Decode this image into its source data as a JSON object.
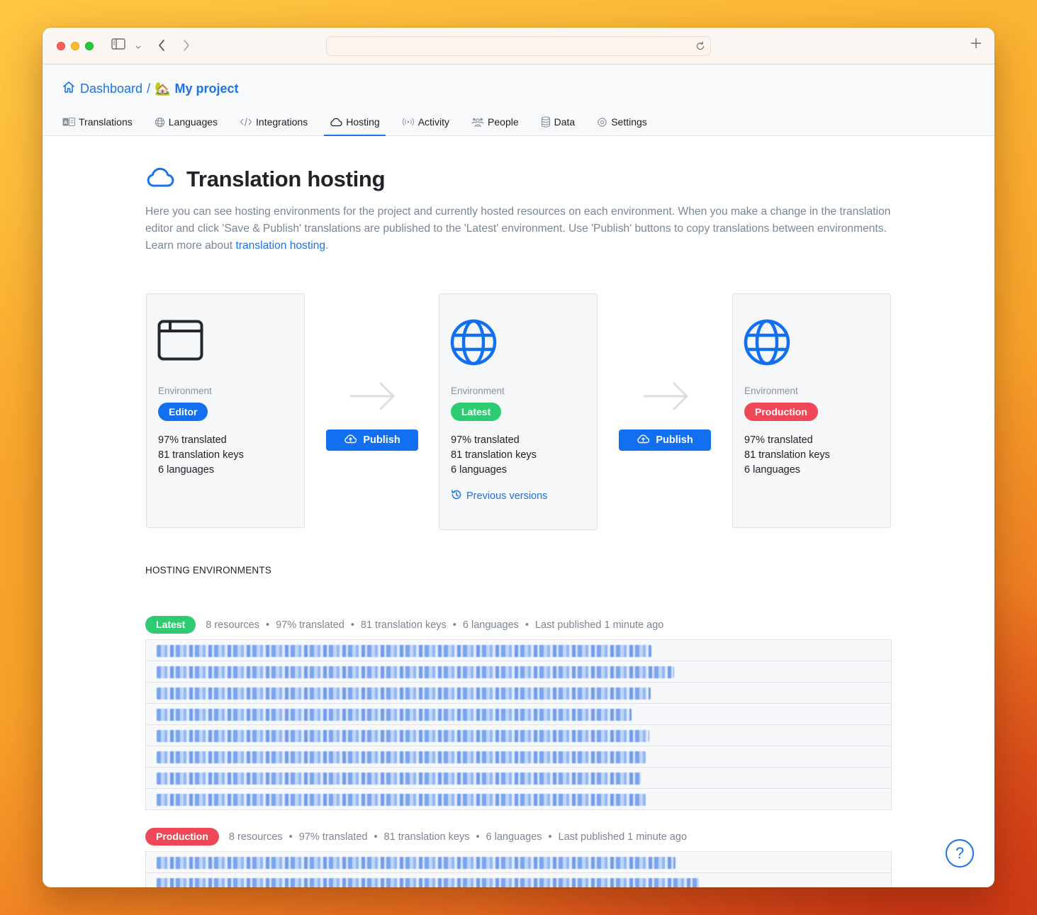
{
  "browser": {
    "address_value": "",
    "address_placeholder": ""
  },
  "breadcrumb": {
    "root_label": "Dashboard",
    "separator": "/",
    "project_emoji": "🏡",
    "project_label": "My project"
  },
  "tabs": [
    {
      "label": "Translations",
      "icon": "translate-icon",
      "active": false
    },
    {
      "label": "Languages",
      "icon": "globe-icon",
      "active": false
    },
    {
      "label": "Integrations",
      "icon": "code-icon",
      "active": false
    },
    {
      "label": "Hosting",
      "icon": "cloud-icon",
      "active": true
    },
    {
      "label": "Activity",
      "icon": "broadcast-icon",
      "active": false
    },
    {
      "label": "People",
      "icon": "people-icon",
      "active": false
    },
    {
      "label": "Data",
      "icon": "database-icon",
      "active": false
    },
    {
      "label": "Settings",
      "icon": "gear-icon",
      "active": false
    }
  ],
  "page": {
    "title": "Translation hosting",
    "intro_text": "Here you can see hosting environments for the project and currently hosted resources on each environment. When you make a change in the translation editor and click 'Save & Publish' translations are published to the 'Latest' environment. Use 'Publish' buttons to copy translations between environments. Learn more about ",
    "intro_link": "translation hosting",
    "intro_end": "."
  },
  "environments": [
    {
      "label": "Environment",
      "name": "Editor",
      "color": "#1270f0",
      "icon": "browser-window-icon",
      "stats": [
        "97% translated",
        "81 translation keys",
        "6 languages"
      ]
    },
    {
      "label": "Environment",
      "name": "Latest",
      "color": "#2ecc71",
      "icon": "globe-icon",
      "stats": [
        "97% translated",
        "81 translation keys",
        "6 languages"
      ],
      "link": "Previous versions"
    },
    {
      "label": "Environment",
      "name": "Production",
      "color": "#ef4757",
      "icon": "globe-icon",
      "stats": [
        "97% translated",
        "81 translation keys",
        "6 languages"
      ]
    }
  ],
  "publish_buttons": [
    {
      "label": "Publish"
    },
    {
      "label": "Publish"
    }
  ],
  "hosting_section": {
    "title": "HOSTING ENVIRONMENTS",
    "groups": [
      {
        "name": "Latest",
        "color": "#2ecc71",
        "meta": [
          "8 resources",
          "97% translated",
          "81 translation keys",
          "6 languages",
          "Last published 1 minute ago"
        ],
        "resources_visible": 8,
        "resources_obscured": true
      },
      {
        "name": "Production",
        "color": "#ef4757",
        "meta": [
          "8 resources",
          "97% translated",
          "81 translation keys",
          "6 languages",
          "Last published 1 minute ago"
        ],
        "resources_visible": 3,
        "resources_obscured": true
      }
    ]
  },
  "help": {
    "label": "?"
  }
}
